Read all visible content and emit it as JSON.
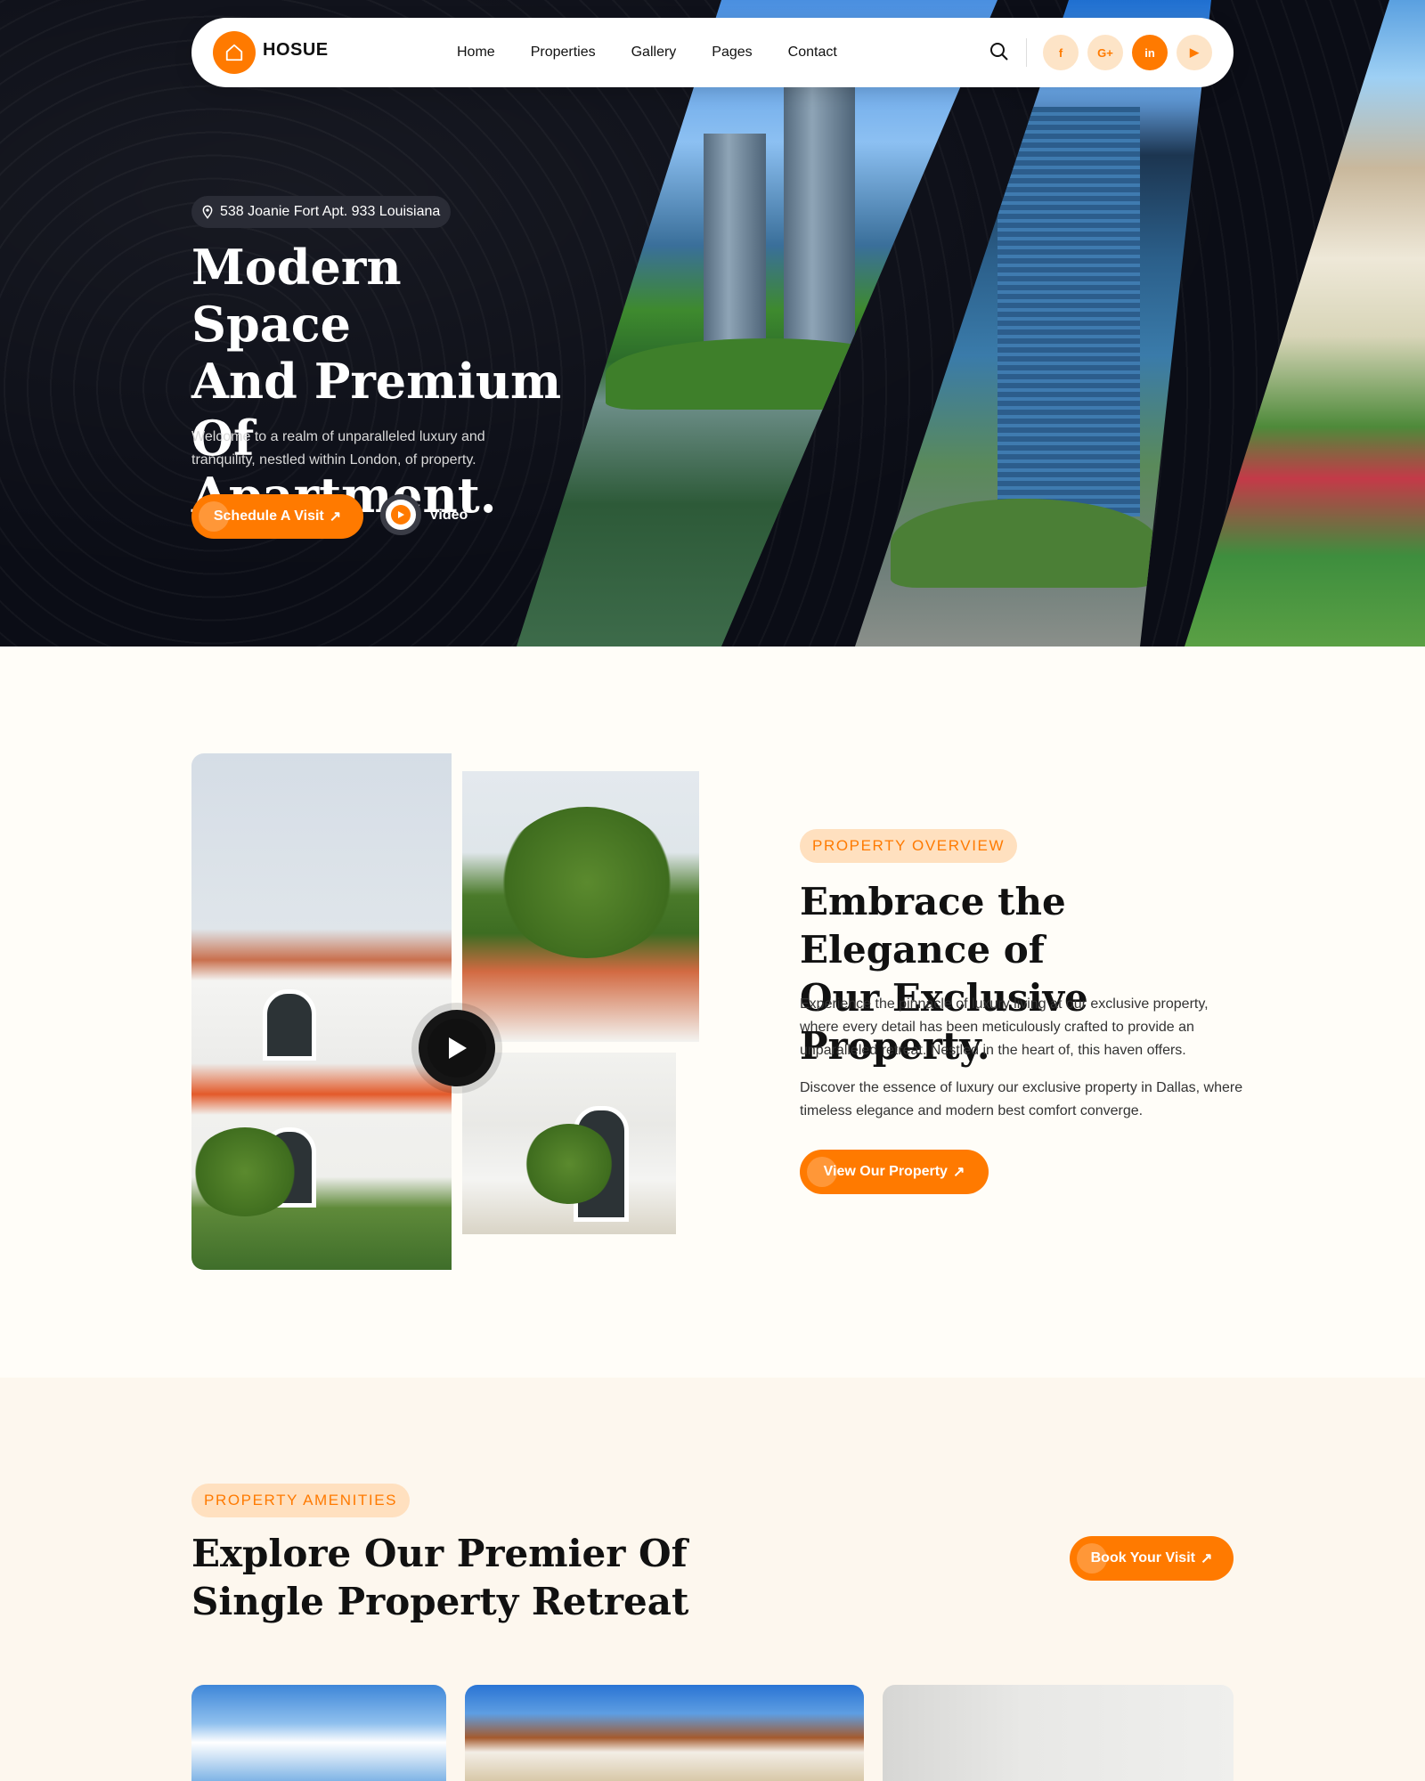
{
  "brand": {
    "name": "HOSUE",
    "accent": "#ff7a00",
    "dark": "#0b0d16"
  },
  "nav": {
    "items": [
      "Home",
      "Properties",
      "Gallery",
      "Pages",
      "Contact"
    ],
    "socials": [
      {
        "icon": "facebook-icon",
        "glyph": "f"
      },
      {
        "icon": "google-plus-icon",
        "glyph": "G+"
      },
      {
        "icon": "linkedin-icon",
        "glyph": "in"
      },
      {
        "icon": "youtube-icon",
        "glyph": "▶"
      }
    ]
  },
  "hero": {
    "address": "538 Joanie Fort Apt. 933 Louisiana",
    "title_lines": [
      "Modern Space",
      "And Premium",
      "Of Apartment."
    ],
    "subtitle": "Welcome to a realm of unparalleled luxury and tranquility, nestled within London, of property.",
    "cta": "Schedule A Visit",
    "video": "Video"
  },
  "overview": {
    "tag": "PROPERTY OVERVIEW",
    "title_lines": [
      "Embrace the Elegance of",
      "Our Exclusive Property."
    ],
    "p1": "Experience the pinnacle of luxury living at our exclusive property, where every detail has been meticulously crafted to provide an unparalleled retreat. Nestled in the heart of, this haven offers.",
    "p2": "Discover the essence of luxury  our exclusive property in Dallas, where timeless elegance and modern best comfort converge.",
    "cta": "View Our Property"
  },
  "amenities": {
    "tag": "PROPERTY AMENITIES",
    "title_lines": [
      "Explore Our Premier Of",
      "Single Property Retreat"
    ],
    "cta": "Book Your Visit"
  }
}
